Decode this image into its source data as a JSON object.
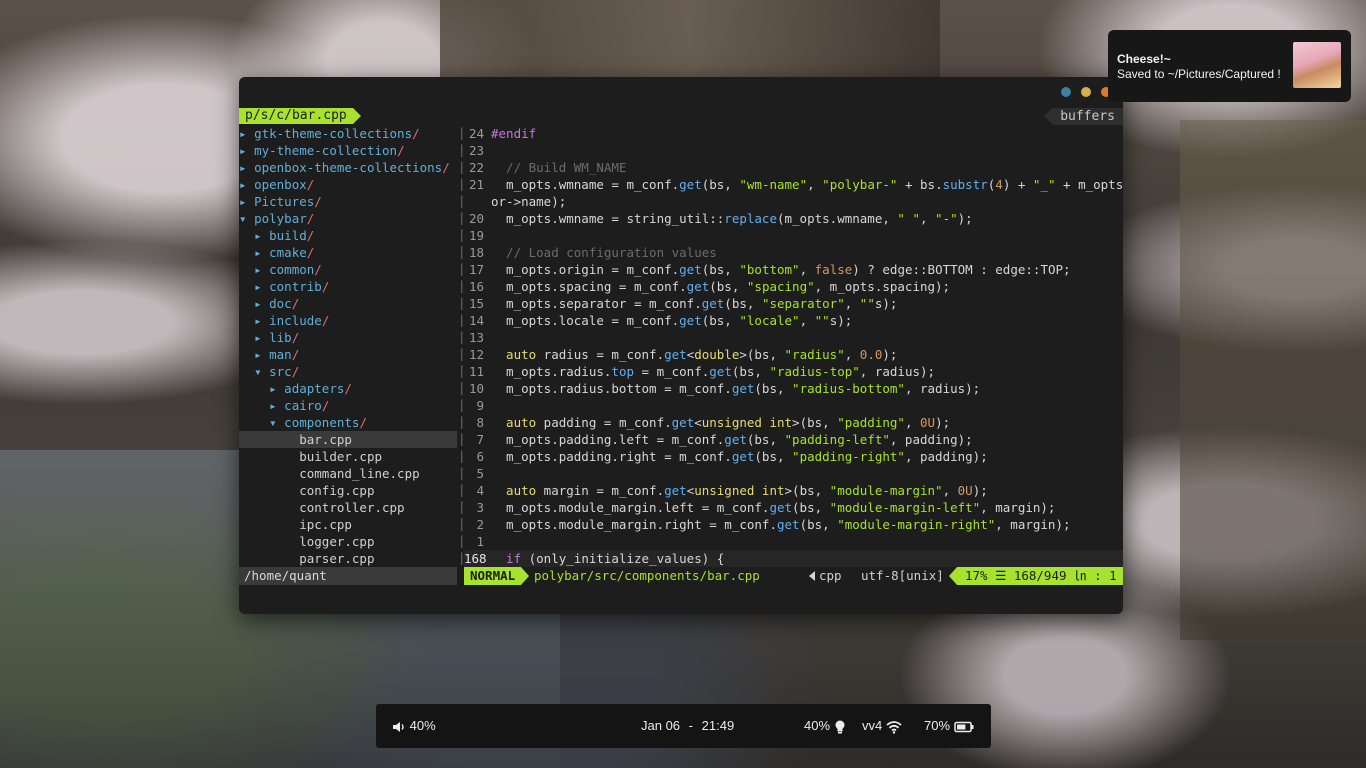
{
  "colors": {
    "accent": "#a6e22e",
    "dot1": "#3f7fa3",
    "dot2": "#d5b04a",
    "dot3": "#d97b2a"
  },
  "tree": {
    "header": "p/s/c/bar.cpp",
    "items": [
      {
        "arrow": "▸",
        "name": "gtk-theme-collections",
        "slash": "/",
        "indent": 0,
        "dir": true
      },
      {
        "arrow": "▸",
        "name": "my-theme-collection",
        "slash": "/",
        "indent": 0,
        "dir": true
      },
      {
        "arrow": "▸",
        "name": "openbox-theme-collections",
        "slash": "/",
        "indent": 0,
        "dir": true
      },
      {
        "arrow": "▸",
        "name": "openbox",
        "slash": "/",
        "indent": 0,
        "dir": true
      },
      {
        "arrow": "▸",
        "name": "Pictures",
        "slash": "/",
        "indent": 0,
        "dir": true
      },
      {
        "arrow": "▾",
        "name": "polybar",
        "slash": "/",
        "indent": 0,
        "dir": true
      },
      {
        "arrow": "▸",
        "name": "build",
        "slash": "/",
        "indent": 1,
        "dir": true
      },
      {
        "arrow": "▸",
        "name": "cmake",
        "slash": "/",
        "indent": 1,
        "dir": true
      },
      {
        "arrow": "▸",
        "name": "common",
        "slash": "/",
        "indent": 1,
        "dir": true
      },
      {
        "arrow": "▸",
        "name": "contrib",
        "slash": "/",
        "indent": 1,
        "dir": true
      },
      {
        "arrow": "▸",
        "name": "doc",
        "slash": "/",
        "indent": 1,
        "dir": true
      },
      {
        "arrow": "▸",
        "name": "include",
        "slash": "/",
        "indent": 1,
        "dir": true
      },
      {
        "arrow": "▸",
        "name": "lib",
        "slash": "/",
        "indent": 1,
        "dir": true
      },
      {
        "arrow": "▸",
        "name": "man",
        "slash": "/",
        "indent": 1,
        "dir": true
      },
      {
        "arrow": "▾",
        "name": "src",
        "slash": "/",
        "indent": 1,
        "dir": true
      },
      {
        "arrow": "▸",
        "name": "adapters",
        "slash": "/",
        "indent": 2,
        "dir": true
      },
      {
        "arrow": "▸",
        "name": "cairo",
        "slash": "/",
        "indent": 2,
        "dir": true
      },
      {
        "arrow": "▾",
        "name": "components",
        "slash": "/",
        "indent": 2,
        "dir": true
      },
      {
        "arrow": "",
        "name": "bar.cpp",
        "slash": "",
        "indent": 4,
        "dir": false,
        "selected": true
      },
      {
        "arrow": "",
        "name": "builder.cpp",
        "slash": "",
        "indent": 4,
        "dir": false
      },
      {
        "arrow": "",
        "name": "command_line.cpp",
        "slash": "",
        "indent": 4,
        "dir": false
      },
      {
        "arrow": "",
        "name": "config.cpp",
        "slash": "",
        "indent": 4,
        "dir": false
      },
      {
        "arrow": "",
        "name": "controller.cpp",
        "slash": "",
        "indent": 4,
        "dir": false
      },
      {
        "arrow": "",
        "name": "ipc.cpp",
        "slash": "",
        "indent": 4,
        "dir": false
      },
      {
        "arrow": "",
        "name": "logger.cpp",
        "slash": "",
        "indent": 4,
        "dir": false
      },
      {
        "arrow": "",
        "name": "parser.cpp",
        "slash": "",
        "indent": 4,
        "dir": false
      }
    ]
  },
  "editor": {
    "buffers_label": "buffers",
    "lines": [
      {
        "num": "24",
        "segs": [
          [
            "pre",
            "#endif"
          ]
        ]
      },
      {
        "num": "23",
        "segs": []
      },
      {
        "num": "22",
        "segs": [
          [
            "com",
            "  // Build WM_NAME"
          ]
        ]
      },
      {
        "num": "21",
        "segs": [
          [
            "",
            "  m_opts.wmname = m_conf."
          ],
          [
            "fn",
            "get"
          ],
          [
            "",
            "(bs, "
          ],
          [
            "str",
            "\"wm-name\""
          ],
          [
            "",
            ", "
          ],
          [
            "str",
            "\"polybar-\""
          ],
          [
            "",
            " + bs."
          ],
          [
            "fn",
            "substr"
          ],
          [
            "",
            "("
          ],
          [
            "kw",
            "4"
          ],
          [
            "",
            ") + "
          ],
          [
            "str",
            "\"_\""
          ],
          [
            "",
            " + m_opts.monit"
          ]
        ]
      },
      {
        "num": "",
        "segs": [
          [
            "",
            "or->name);"
          ]
        ]
      },
      {
        "num": "20",
        "segs": [
          [
            "",
            "  m_opts.wmname = string_util::"
          ],
          [
            "fn",
            "replace"
          ],
          [
            "",
            "(m_opts.wmname, "
          ],
          [
            "str",
            "\" \""
          ],
          [
            "",
            ", "
          ],
          [
            "str",
            "\"-\""
          ],
          [
            "",
            ");"
          ]
        ]
      },
      {
        "num": "19",
        "segs": []
      },
      {
        "num": "18",
        "segs": [
          [
            "com",
            "  // Load configuration values"
          ]
        ]
      },
      {
        "num": "17",
        "segs": [
          [
            "",
            "  m_opts.origin = m_conf."
          ],
          [
            "fn",
            "get"
          ],
          [
            "",
            "(bs, "
          ],
          [
            "str",
            "\"bottom\""
          ],
          [
            "",
            ", "
          ],
          [
            "kw",
            "false"
          ],
          [
            "",
            ") ? edge::BOTTOM : edge::TOP;"
          ]
        ]
      },
      {
        "num": "16",
        "segs": [
          [
            "",
            "  m_opts.spacing = m_conf."
          ],
          [
            "fn",
            "get"
          ],
          [
            "",
            "(bs, "
          ],
          [
            "str",
            "\"spacing\""
          ],
          [
            "",
            ", m_opts.spacing);"
          ]
        ]
      },
      {
        "num": "15",
        "segs": [
          [
            "",
            "  m_opts.separator = m_conf."
          ],
          [
            "fn",
            "get"
          ],
          [
            "",
            "(bs, "
          ],
          [
            "str",
            "\"separator\""
          ],
          [
            "",
            ", "
          ],
          [
            "str",
            "\"\""
          ],
          [
            "",
            "s);"
          ]
        ]
      },
      {
        "num": "14",
        "segs": [
          [
            "",
            "  m_opts.locale = m_conf."
          ],
          [
            "fn",
            "get"
          ],
          [
            "",
            "(bs, "
          ],
          [
            "str",
            "\"locale\""
          ],
          [
            "",
            ", "
          ],
          [
            "str",
            "\"\""
          ],
          [
            "",
            "s);"
          ]
        ]
      },
      {
        "num": "13",
        "segs": []
      },
      {
        "num": "12",
        "segs": [
          [
            "ty",
            "  auto"
          ],
          [
            "",
            " radius = m_conf."
          ],
          [
            "fn",
            "get"
          ],
          [
            "",
            "<"
          ],
          [
            "ty",
            "double"
          ],
          [
            "",
            ">(bs, "
          ],
          [
            "str",
            "\"radius\""
          ],
          [
            "",
            ", "
          ],
          [
            "kw",
            "0.0"
          ],
          [
            "",
            ");"
          ]
        ]
      },
      {
        "num": "11",
        "segs": [
          [
            "",
            "  m_opts.radius."
          ],
          [
            "fn",
            "top"
          ],
          [
            "",
            " = m_conf."
          ],
          [
            "fn",
            "get"
          ],
          [
            "",
            "(bs, "
          ],
          [
            "str",
            "\"radius-top\""
          ],
          [
            "",
            ", radius);"
          ]
        ]
      },
      {
        "num": "10",
        "segs": [
          [
            "",
            "  m_opts.radius.bottom = m_conf."
          ],
          [
            "fn",
            "get"
          ],
          [
            "",
            "(bs, "
          ],
          [
            "str",
            "\"radius-bottom\""
          ],
          [
            "",
            ", radius);"
          ]
        ]
      },
      {
        "num": "9",
        "segs": []
      },
      {
        "num": "8",
        "segs": [
          [
            "ty",
            "  auto"
          ],
          [
            "",
            " padding = m_conf."
          ],
          [
            "fn",
            "get"
          ],
          [
            "",
            "<"
          ],
          [
            "ty",
            "unsigned int"
          ],
          [
            "",
            ">(bs, "
          ],
          [
            "str",
            "\"padding\""
          ],
          [
            "",
            ", "
          ],
          [
            "kw",
            "0U"
          ],
          [
            "",
            ");"
          ]
        ]
      },
      {
        "num": "7",
        "segs": [
          [
            "",
            "  m_opts.padding.left = m_conf."
          ],
          [
            "fn",
            "get"
          ],
          [
            "",
            "(bs, "
          ],
          [
            "str",
            "\"padding-left\""
          ],
          [
            "",
            ", padding);"
          ]
        ]
      },
      {
        "num": "6",
        "segs": [
          [
            "",
            "  m_opts.padding.right = m_conf."
          ],
          [
            "fn",
            "get"
          ],
          [
            "",
            "(bs, "
          ],
          [
            "str",
            "\"padding-right\""
          ],
          [
            "",
            ", padding);"
          ]
        ]
      },
      {
        "num": "5",
        "segs": []
      },
      {
        "num": "4",
        "segs": [
          [
            "ty",
            "  auto"
          ],
          [
            "",
            " margin = m_conf."
          ],
          [
            "fn",
            "get"
          ],
          [
            "",
            "<"
          ],
          [
            "ty",
            "unsigned int"
          ],
          [
            "",
            ">(bs, "
          ],
          [
            "str",
            "\"module-margin\""
          ],
          [
            "",
            ", "
          ],
          [
            "kw",
            "0U"
          ],
          [
            "",
            ");"
          ]
        ]
      },
      {
        "num": "3",
        "segs": [
          [
            "",
            "  m_opts.module_margin.left = m_conf."
          ],
          [
            "fn",
            "get"
          ],
          [
            "",
            "(bs, "
          ],
          [
            "str",
            "\"module-margin-left\""
          ],
          [
            "",
            ", margin);"
          ]
        ]
      },
      {
        "num": "2",
        "segs": [
          [
            "",
            "  m_opts.module_margin.right = m_conf."
          ],
          [
            "fn",
            "get"
          ],
          [
            "",
            "(bs, "
          ],
          [
            "str",
            "\"module-margin-right\""
          ],
          [
            "",
            ", margin);"
          ]
        ]
      },
      {
        "num": "1",
        "segs": []
      },
      {
        "num": "168",
        "current": true,
        "segs": [
          [
            "pre",
            "  if"
          ],
          [
            "",
            " (only_initialize_values) {"
          ]
        ]
      }
    ]
  },
  "statusline": {
    "cwd": "/home/quant",
    "mode": "NORMAL",
    "file": "polybar/src/components/bar.cpp",
    "filetype": "cpp",
    "encoding": "utf-8[unix]",
    "position": "17% ☰  168/949 ㏑ :  1"
  },
  "notification": {
    "title": "Cheese!~",
    "body": "Saved to ~/Pictures/Captured !"
  },
  "bar": {
    "volume": "40%",
    "date": "Jan 06",
    "sep": "-",
    "time": "21:49",
    "brightness": "40%",
    "network": "vv4",
    "battery": "70%"
  }
}
